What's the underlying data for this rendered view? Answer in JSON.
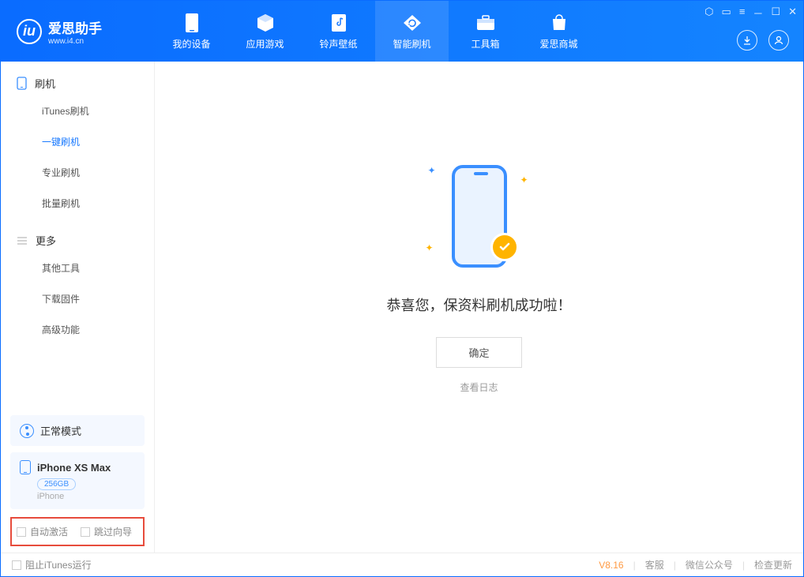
{
  "branding": {
    "name": "爱思助手",
    "url": "www.i4.cn",
    "logo_letter": "iu"
  },
  "nav": {
    "items": [
      {
        "label": "我的设备",
        "icon": "device"
      },
      {
        "label": "应用游戏",
        "icon": "cube"
      },
      {
        "label": "铃声壁纸",
        "icon": "music"
      },
      {
        "label": "智能刷机",
        "icon": "refresh"
      },
      {
        "label": "工具箱",
        "icon": "toolbox"
      },
      {
        "label": "爱思商城",
        "icon": "bag"
      }
    ],
    "active_index": 3
  },
  "sidebar": {
    "sections": [
      {
        "title": "刷机",
        "items": [
          {
            "label": "iTunes刷机"
          },
          {
            "label": "一键刷机",
            "active": true
          },
          {
            "label": "专业刷机"
          },
          {
            "label": "批量刷机"
          }
        ]
      },
      {
        "title": "更多",
        "items": [
          {
            "label": "其他工具"
          },
          {
            "label": "下载固件"
          },
          {
            "label": "高级功能"
          }
        ]
      }
    ],
    "mode_card": {
      "label": "正常模式"
    },
    "device_card": {
      "name": "iPhone XS Max",
      "storage": "256GB",
      "type": "iPhone"
    },
    "checkboxes": {
      "auto_activate": "自动激活",
      "skip_guide": "跳过向导"
    }
  },
  "main_panel": {
    "success_message": "恭喜您，保资料刷机成功啦！",
    "ok_button": "确定",
    "view_log": "查看日志"
  },
  "footer": {
    "block_itunes": "阻止iTunes运行",
    "version": "V8.16",
    "links": {
      "support": "客服",
      "wechat": "微信公众号",
      "check_update": "检查更新"
    }
  }
}
